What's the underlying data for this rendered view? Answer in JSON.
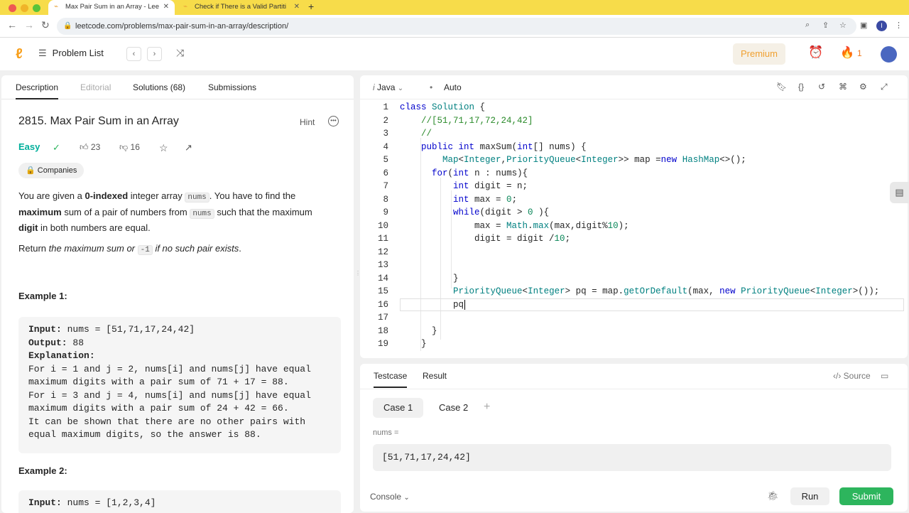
{
  "browser": {
    "tabs": [
      {
        "title": "Max Pair Sum in an Array - Lee"
      },
      {
        "title": "Check if There is a Valid Partiti"
      }
    ],
    "url": "leetcode.com/problems/max-pair-sum-in-an-array/description/",
    "profile_initial": "I"
  },
  "header": {
    "problem_list": "Problem List",
    "premium": "Premium",
    "streak": "1"
  },
  "left": {
    "tabs": [
      "Description",
      "Editorial",
      "Solutions (68)",
      "Submissions"
    ],
    "title": "2815. Max Pair Sum in an Array",
    "hint": "Hint",
    "difficulty": "Easy",
    "likes": "23",
    "dislikes": "16",
    "companies": "Companies",
    "p1": {
      "a": "You are given a ",
      "b": "0-indexed",
      "c": " integer array ",
      "d": "nums",
      "e": ". You have to find the ",
      "f": "maximum",
      "g": " sum of a pair of numbers from ",
      "h": "nums",
      "i": " such that the maximum ",
      "j": "digit",
      "k": " in both numbers are equal."
    },
    "p2": {
      "a": "Return ",
      "b": "the maximum sum or ",
      "c": "-1",
      "d": " if no such pair exists",
      "e": "."
    },
    "ex1": {
      "heading": "Example 1:",
      "lines": [
        "Input: nums = [51,71,17,24,42]",
        "Output: 88",
        "Explanation:",
        "For i = 1 and j = 2, nums[i] and nums[j] have equal",
        "maximum digits with a pair sum of 71 + 17 = 88.",
        "For i = 3 and j = 4, nums[i] and nums[j] have equal",
        "maximum digits with a pair sum of 24 + 42 = 66.",
        "It can be shown that there are no other pairs with",
        "equal maximum digits, so the answer is 88."
      ]
    },
    "ex2": {
      "heading": "Example 2:",
      "input": "Input: nums = [1,2,3,4]"
    }
  },
  "editor": {
    "language": "Java",
    "mode": "Auto",
    "line_numbers": [
      "1",
      "2",
      "3",
      "4",
      "5",
      "6",
      "7",
      "8",
      "9",
      "10",
      "11",
      "12",
      "13",
      "14",
      "15",
      "16",
      "17",
      "18",
      "19"
    ]
  },
  "testcase": {
    "tabs": [
      "Testcase",
      "Result"
    ],
    "source": "Source",
    "cases": [
      "Case 1",
      "Case 2"
    ],
    "var_label": "nums =",
    "var_value": "[51,71,17,24,42]",
    "console": "Console",
    "run": "Run",
    "submit": "Submit"
  },
  "icons": [
    "back-icon",
    "forward-icon",
    "reload-icon",
    "lock-icon",
    "zoom-icon",
    "share-icon",
    "star-icon",
    "sidepanel-icon",
    "menu-icon",
    "leetcode-logo",
    "list-icon",
    "chevron-left-icon",
    "chevron-right-icon",
    "shuffle-icon",
    "alarm-icon",
    "fire-icon",
    "check-circle-icon",
    "thumbs-up-icon",
    "thumbs-down-icon",
    "star-icon",
    "share-icon",
    "lock-icon",
    "bookmark-icon",
    "braces-icon",
    "reset-icon",
    "settings-icon",
    "expand-icon",
    "bug-icon",
    "layout-icon"
  ]
}
